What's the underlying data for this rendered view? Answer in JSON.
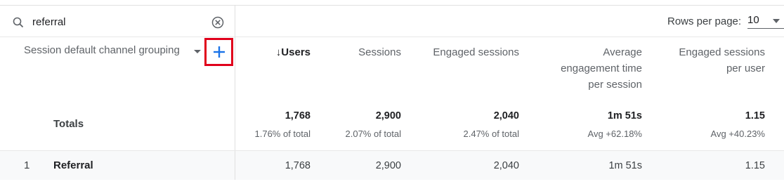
{
  "search": {
    "value": "referral",
    "icon": "search-icon",
    "clear_icon": "clear-circle-icon"
  },
  "pagination": {
    "rows_per_page_label": "Rows per page:",
    "rows_per_page_value": "10"
  },
  "table": {
    "dimension_header": "Session default channel grouping",
    "add_dimension_icon": "plus-icon",
    "columns": [
      {
        "label": "↓Users",
        "sorted": true
      },
      {
        "label": "Sessions"
      },
      {
        "label": "Engaged sessions"
      },
      {
        "label_lines": [
          "Average",
          "engagement time",
          "per session"
        ]
      },
      {
        "label_lines": [
          "Engaged sessions",
          "per user"
        ]
      }
    ],
    "totals": {
      "label": "Totals",
      "values": [
        "1,768",
        "2,900",
        "2,040",
        "1m 51s",
        "1.15"
      ],
      "subtexts": [
        "1.76% of total",
        "2.07% of total",
        "2.47% of total",
        "Avg +62.18%",
        "Avg +40.23%"
      ]
    },
    "rows": [
      {
        "index": "1",
        "name": "Referral",
        "values": [
          "1,768",
          "2,900",
          "2,040",
          "1m 51s",
          "1.15"
        ]
      }
    ]
  },
  "colors": {
    "highlight_border": "#e0001b",
    "accent": "#1a73e8"
  }
}
